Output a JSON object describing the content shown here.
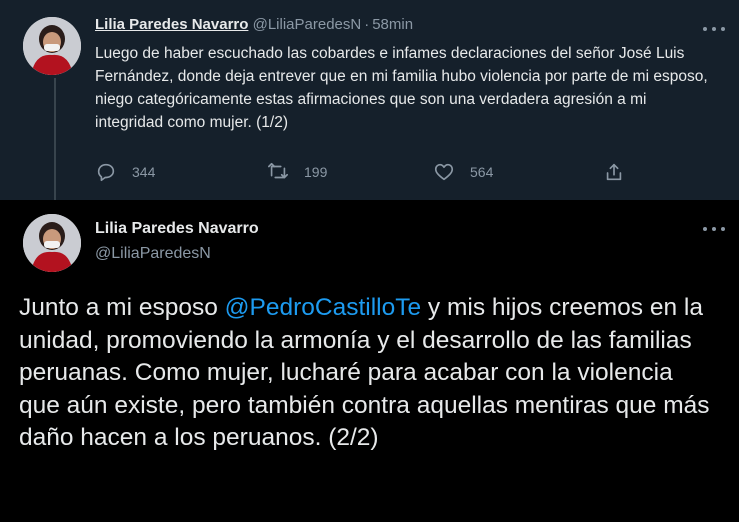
{
  "tweet1": {
    "name": "Lilia Paredes Navarro",
    "handle": "@LiliaParedesN",
    "separator": "·",
    "time": "58min",
    "text": "Luego de haber escuchado las cobardes e infames declaraciones del señor José Luis Fernández, donde deja entrever que en mi familia hubo violencia por parte de mi esposo, niego categóricamente estas afirmaciones que son una verdadera agresión a mi integridad como mujer. (1/2)",
    "actions": {
      "reply_icon": "reply-icon",
      "reply_count": "344",
      "retweet_icon": "retweet-icon",
      "retweet_count": "199",
      "like_icon": "heart-icon",
      "like_count": "564",
      "share_icon": "share-icon"
    }
  },
  "tweet2": {
    "name": "Lilia Paredes Navarro",
    "handle": "@LiliaParedesN",
    "text_before": "Junto a mi esposo ",
    "mention": "@PedroCastilloTe",
    "text_after": " y mis hijos creemos en la unidad, promoviendo la armonía y el desarrollo de las familias peruanas. Como mujer, lucharé para acabar con la violencia que aún existe, pero también contra aquellas mentiras que más daño hacen a los peruanos. (2/2)"
  },
  "colors": {
    "background_top": "#15202b",
    "background_bottom": "#000000",
    "text": "#e7e9ea",
    "secondary": "#8b98a5",
    "link": "#1d9bf0"
  }
}
